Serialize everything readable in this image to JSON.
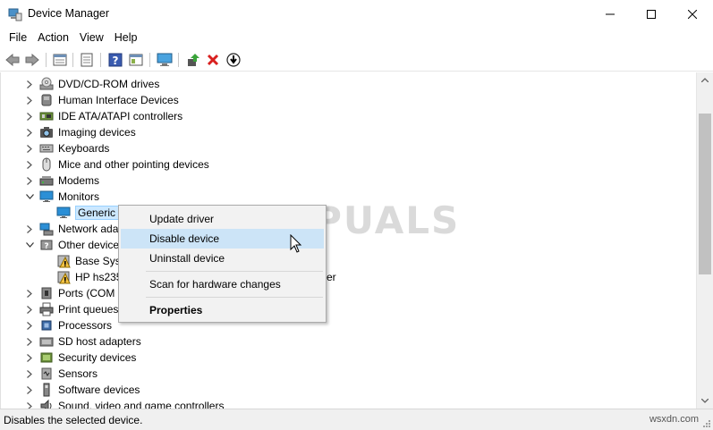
{
  "window": {
    "title": "Device Manager"
  },
  "menu": [
    "File",
    "Action",
    "View",
    "Help"
  ],
  "toolbar": {
    "icons": [
      "back-arrow-icon",
      "forward-arrow-icon",
      "properties-icon",
      "list-icon",
      "help-icon",
      "view-icon",
      "monitor-scan-icon",
      "update-driver-icon",
      "uninstall-x-icon",
      "download-icon"
    ]
  },
  "tree": [
    {
      "label": "DVD/CD-ROM drives",
      "expanded": false,
      "icon": "dvd-drive-icon",
      "level": 0
    },
    {
      "label": "Human Interface Devices",
      "expanded": false,
      "icon": "hid-icon",
      "level": 0
    },
    {
      "label": "IDE ATA/ATAPI controllers",
      "expanded": false,
      "icon": "ide-controller-icon",
      "level": 0
    },
    {
      "label": "Imaging devices",
      "expanded": false,
      "icon": "camera-icon",
      "level": 0
    },
    {
      "label": "Keyboards",
      "expanded": false,
      "icon": "keyboard-icon",
      "level": 0
    },
    {
      "label": "Mice and other pointing devices",
      "expanded": false,
      "icon": "mouse-icon",
      "level": 0
    },
    {
      "label": "Modems",
      "expanded": false,
      "icon": "modem-icon",
      "level": 0
    },
    {
      "label": "Monitors",
      "expanded": true,
      "icon": "monitor-icon",
      "level": 0
    },
    {
      "label": "Generic P",
      "icon": "monitor-icon",
      "level": 1,
      "selected": true
    },
    {
      "label": "Network ada",
      "expanded": false,
      "icon": "network-icon",
      "level": 0
    },
    {
      "label": "Other device",
      "expanded": true,
      "icon": "other-devices-icon",
      "level": 0
    },
    {
      "label": "Base Syst",
      "icon": "warning-device-icon",
      "level": 1
    },
    {
      "label": "HP hs235",
      "icon": "warning-device-icon",
      "level": 1,
      "trail": "er"
    },
    {
      "label": "Ports (COM",
      "expanded": false,
      "icon": "port-icon",
      "level": 0
    },
    {
      "label": "Print queues",
      "expanded": false,
      "icon": "printer-icon",
      "level": 0
    },
    {
      "label": "Processors",
      "expanded": false,
      "icon": "processor-icon",
      "level": 0
    },
    {
      "label": "SD host adapters",
      "expanded": false,
      "icon": "sd-card-icon",
      "level": 0
    },
    {
      "label": "Security devices",
      "expanded": false,
      "icon": "security-icon",
      "level": 0
    },
    {
      "label": "Sensors",
      "expanded": false,
      "icon": "sensor-icon",
      "level": 0
    },
    {
      "label": "Software devices",
      "expanded": false,
      "icon": "software-device-icon",
      "level": 0
    },
    {
      "label": "Sound, video and game controllers",
      "expanded": false,
      "icon": "sound-icon",
      "level": 0
    }
  ],
  "context_menu": {
    "items": [
      {
        "label": "Update driver",
        "highlighted": false
      },
      {
        "label": "Disable device",
        "highlighted": true
      },
      {
        "label": "Uninstall device",
        "highlighted": false
      },
      {
        "label": "Scan for hardware changes",
        "highlighted": false
      },
      {
        "label": "Properties",
        "bold": true
      }
    ]
  },
  "status": {
    "text": "Disables the selected device.",
    "site": "wsxdn.com"
  },
  "watermark": "A PUALS",
  "colors": {
    "selection_bg": "#cce8ff",
    "menu_highlight": "#cce4f7",
    "monitor_blue": "#2b8fd6",
    "warning_yellow": "#f6c343",
    "close_red": "#d9201f"
  }
}
